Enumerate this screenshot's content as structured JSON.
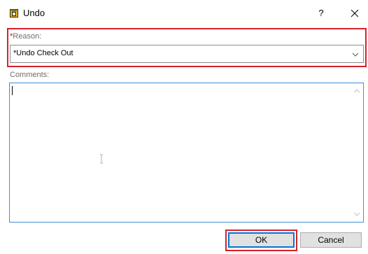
{
  "window": {
    "title": "Undo",
    "help_label": "?",
    "icons": {
      "app": "undo-app-icon",
      "close": "close-icon"
    }
  },
  "reason": {
    "required_mark": "*",
    "label": "Reason:",
    "selected_value": "*Undo Check Out",
    "highlight_color": "#d7212d"
  },
  "comments": {
    "label": "Comments:",
    "value": "",
    "focus_color": "#3c8fd9"
  },
  "buttons": {
    "ok_label": "OK",
    "cancel_label": "Cancel"
  }
}
